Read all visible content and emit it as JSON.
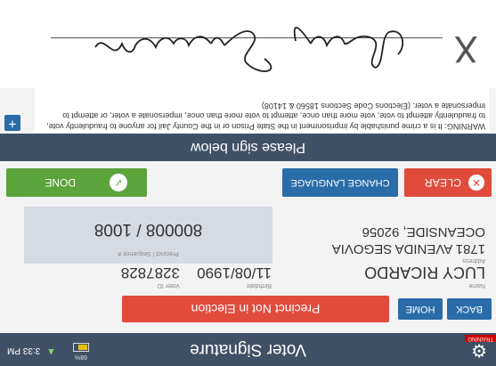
{
  "header": {
    "title": "Voter Signature",
    "training_badge": "TRAINING",
    "battery": {
      "percent_label": "68%",
      "level": 0.68
    },
    "time": "3:33 PM",
    "icons": {
      "settings": "gear-icon",
      "wifi": "wifi-icon",
      "battery": "battery-icon"
    }
  },
  "nav": {
    "back": "BACK",
    "home": "HOME"
  },
  "precinct_alert": "Precinct Not in Election",
  "voter": {
    "name_label": "Name",
    "name": "LUCY RICARDO",
    "birthdate_label": "Birthdate",
    "birthdate": "11/08/1990",
    "voter_id_label": "Voter ID",
    "voter_id": "3287828",
    "address_label": "Address",
    "address_line1": "1781 AVENIDA SEGOVIA",
    "address_line2": "OCEANSIDE, 92056",
    "precinct_label": "Precinct / Sequence #",
    "precinct_value": "800008 / 1008"
  },
  "actions": {
    "clear": "CLEAR",
    "change_language": "CHANGE LANGUAGE",
    "done": "DONE"
  },
  "sign_prompt": "Please sign below",
  "warning": "WARNING: It is a crime punishable by imprisonment in the State Prison or in the County Jail for anyone to fraudulently vote, to fraudulently attempt to vote, vote more than once, attempt to vote more than once, impersonate a voter, or attempt to impersonate a voter. (Elections Code Sections 18560 & 14108)",
  "signature": {
    "text": "Lucy Ricardo",
    "x_mark": "X"
  },
  "colors": {
    "header": "#3f5166",
    "primary": "#2a6ca8",
    "danger": "#e04b3c",
    "success": "#5ba33b"
  }
}
